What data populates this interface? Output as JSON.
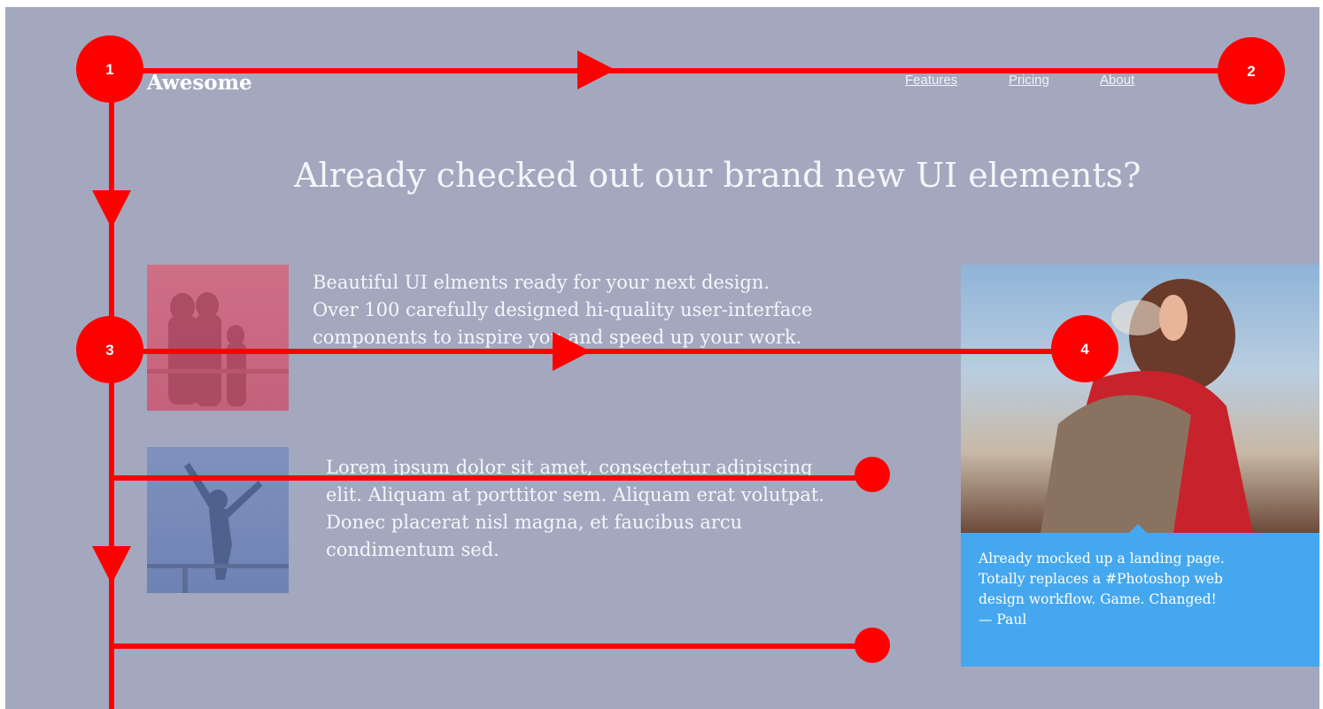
{
  "header": {
    "brand": "Awesome",
    "nav": [
      "Features",
      "Pricing",
      "About"
    ]
  },
  "headline": "Already checked out our brand new UI elements?",
  "features": [
    {
      "lines": [
        "Beautiful UI elments ready for your next design.",
        "Over 100 carefully designed hi-quality user-interface",
        "components to inspire you and speed up your work."
      ]
    },
    {
      "lines": [
        "Lorem ipsum dolor sit amet, consectetur adipiscing",
        "elit. Aliquam at porttitor sem. Aliquam erat volutpat.",
        "Donec placerat nisl magna, et faucibus arcu",
        "condimentum sed."
      ]
    }
  ],
  "testimonial": {
    "lines": [
      "Already mocked up a landing page.",
      "Totally replaces a #Photoshop web",
      "design workflow. Game. Changed!"
    ],
    "author": "— Paul"
  },
  "markers": [
    "1",
    "2",
    "3",
    "4"
  ],
  "colors": {
    "background": "#a3a8bf",
    "overlay_red": "#ff0000",
    "testimonial_blue": "#45a7ee"
  }
}
